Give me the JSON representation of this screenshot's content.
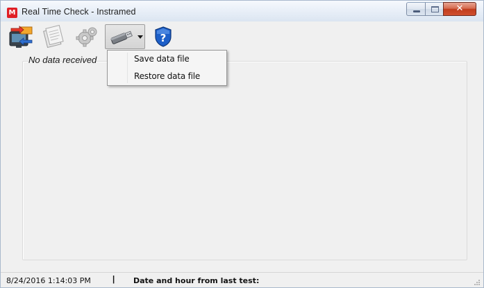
{
  "window": {
    "title": "Real Time Check - Instramed",
    "app_icon_letter": "M",
    "controls": {
      "minimize": "minimize",
      "maximize": "maximize",
      "close": "✕"
    }
  },
  "toolbar": {
    "buttons": [
      {
        "name": "monitor-transfer",
        "icon": "monitor-transfer-icon"
      },
      {
        "name": "documents",
        "icon": "documents-icon"
      },
      {
        "name": "settings",
        "icon": "gear-icon"
      },
      {
        "name": "usb-data",
        "icon": "usb-drive-icon",
        "has_dropdown": true,
        "pressed": true
      },
      {
        "name": "help",
        "icon": "help-shield-icon"
      }
    ]
  },
  "menu": {
    "items": [
      "Save data file",
      "Restore data file"
    ]
  },
  "main": {
    "status_message": "No data received"
  },
  "statusbar": {
    "datetime": "8/24/2016 1:14:03 PM",
    "separator": "|",
    "last_test_label": "Date and hour from last test:"
  },
  "colors": {
    "accent_red": "#e01f26",
    "help_blue": "#1d5fc8",
    "close_button": "#c13d1e"
  }
}
